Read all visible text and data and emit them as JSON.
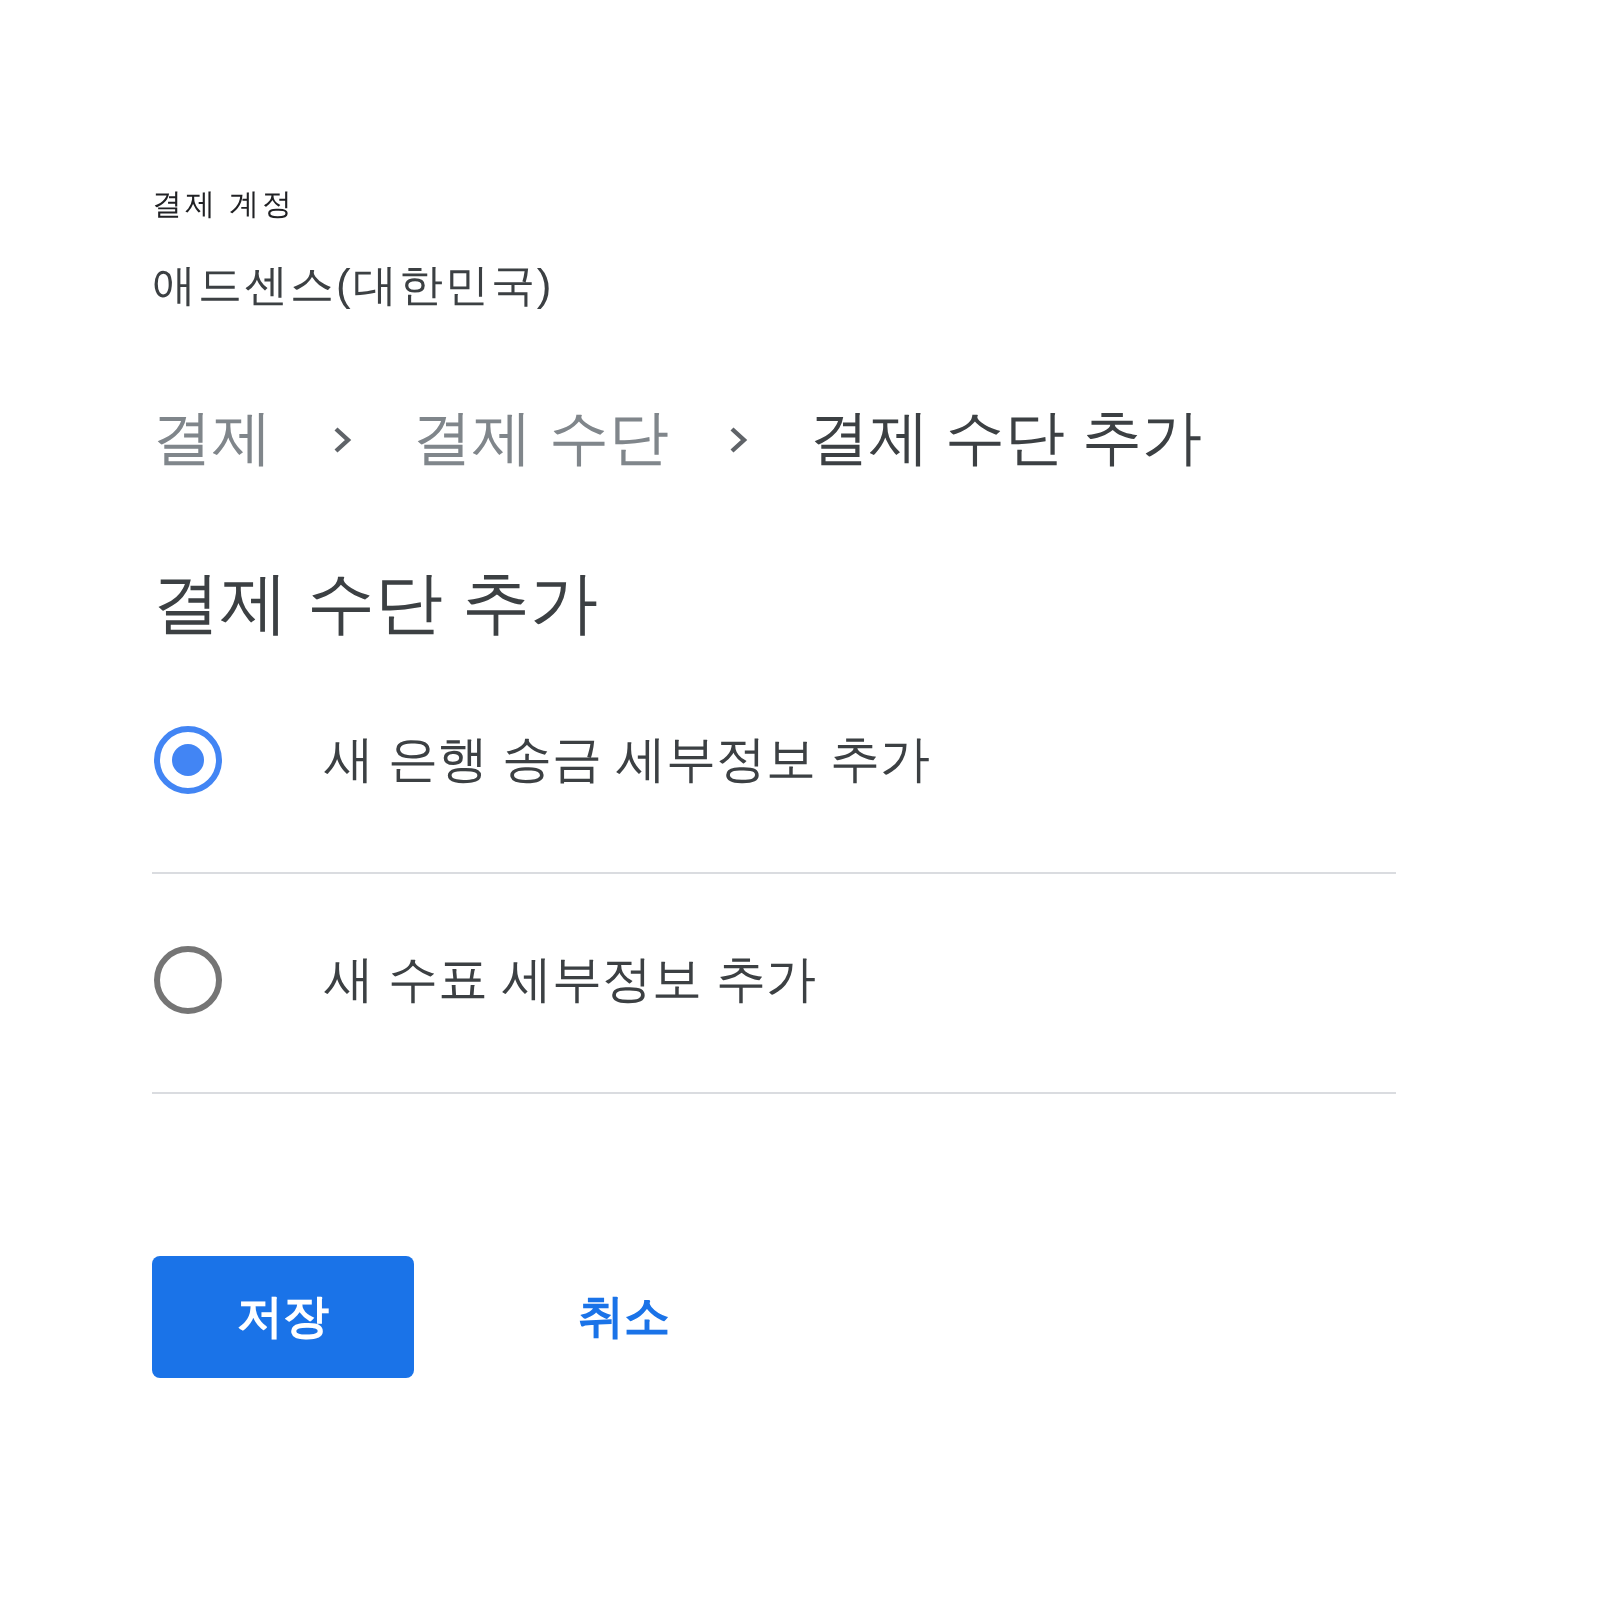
{
  "account": {
    "label": "결제 계정",
    "name": "애드센스(대한민국)"
  },
  "breadcrumb": [
    {
      "label": "결제",
      "current": false
    },
    {
      "label": "결제 수단",
      "current": false
    },
    {
      "label": "결제 수단 추가",
      "current": true
    }
  ],
  "heading": "결제 수단 추가",
  "options": [
    {
      "label": "새 은행 송금 세부정보 추가",
      "selected": true
    },
    {
      "label": "새 수표 세부정보 추가",
      "selected": false
    }
  ],
  "buttons": [
    {
      "kind": "primary",
      "label": "저장"
    },
    {
      "kind": "text",
      "label": "취소"
    }
  ]
}
